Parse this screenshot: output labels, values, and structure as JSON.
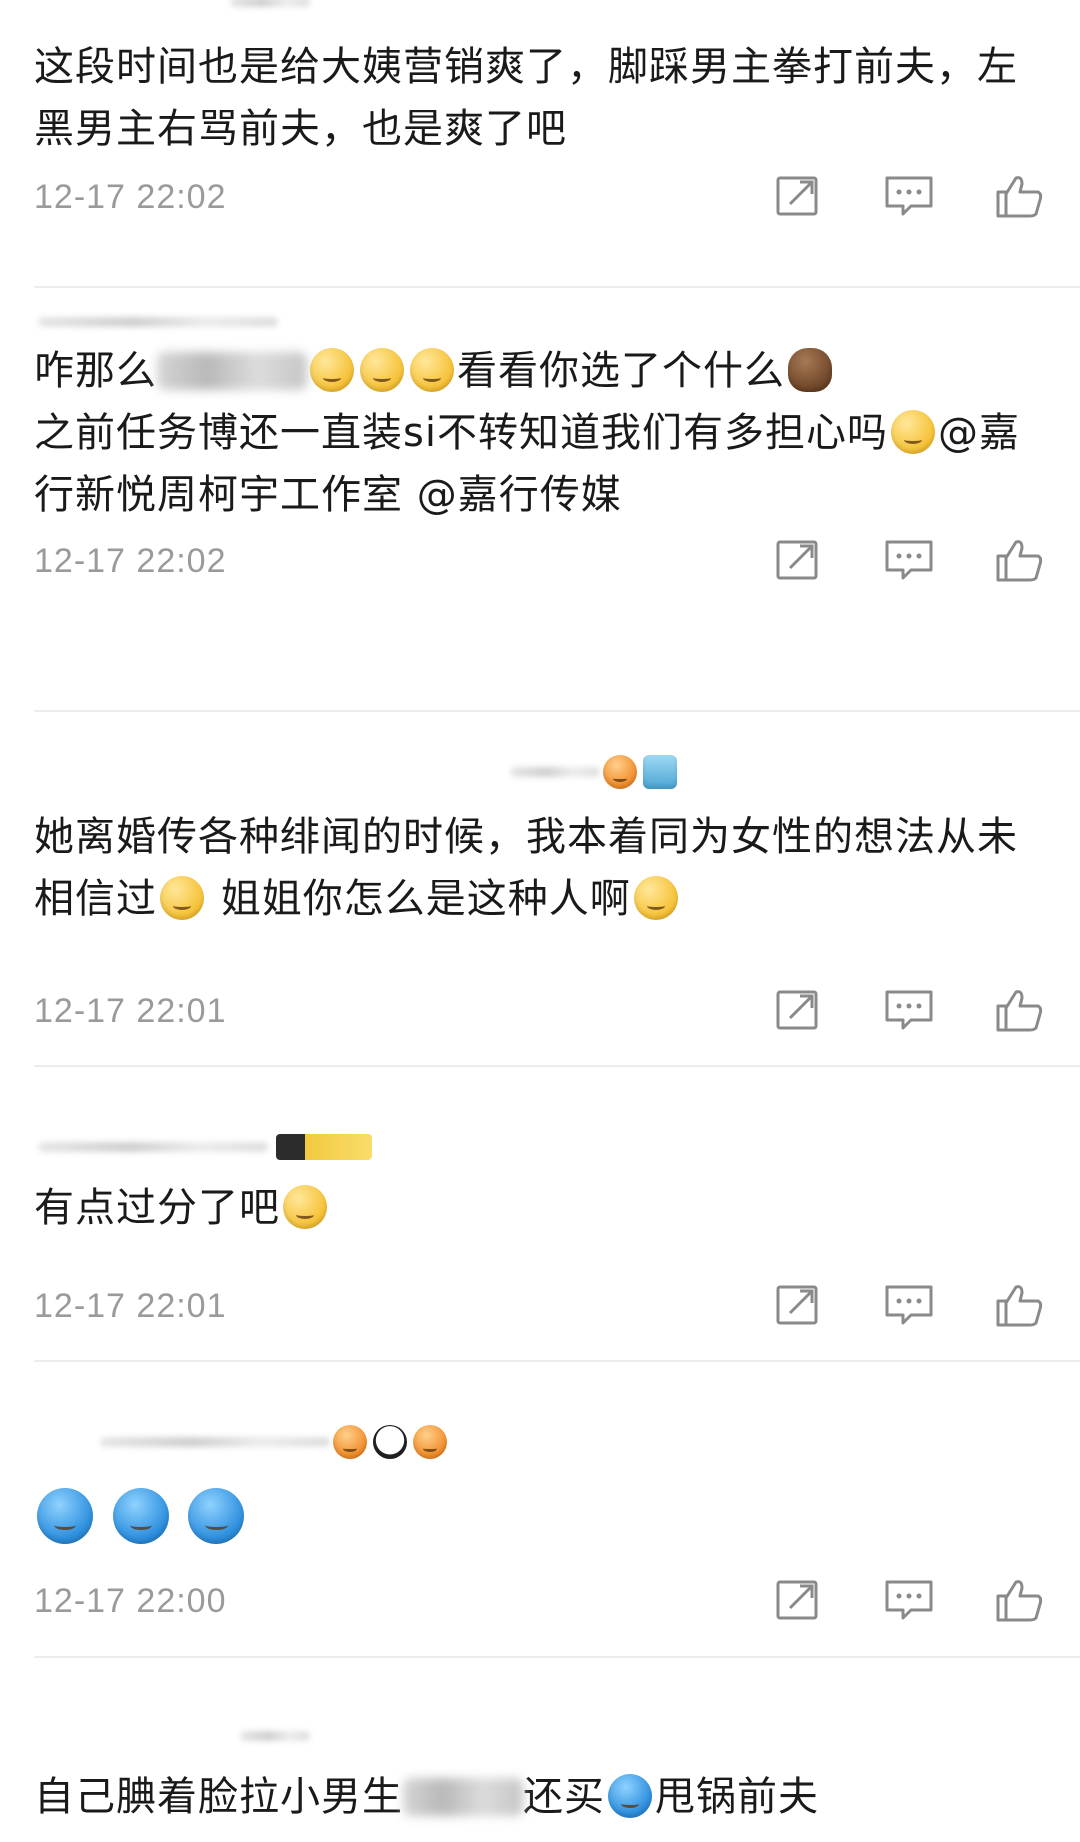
{
  "comments": [
    {
      "text": "这段时间也是给大姨营销爽了，脚踩男主拳打前夫，左黑男主右骂前夫，也是爽了吧",
      "time": "12-17 22:02"
    },
    {
      "text_a": "咋那么",
      "text_b": "看看你选了个什么",
      "text_c": "之前任务博还一直装si不转知道我们有多担心吗",
      "text_d": "@嘉行新悦周柯宇工作室 @嘉行传媒",
      "time": "12-17 22:02"
    },
    {
      "text_a": "她离婚传各种绯闻的时候，我本着同为女性的想法从未相信过",
      "text_b": "姐姐你怎么是这种人啊",
      "time": "12-17 22:01"
    },
    {
      "text": "有点过分了吧",
      "time": "12-17 22:01"
    },
    {
      "time": "12-17 22:00"
    },
    {
      "text_a": "自己腆着脸拉小男生",
      "text_b": "还买",
      "text_c": "甩锅前夫"
    }
  ],
  "icons": {
    "share": "share-icon",
    "comment": "comment-icon",
    "like": "like-icon"
  },
  "colors": {
    "timestamp": "#9a9a9a",
    "icon": "#8a8a8a",
    "divider": "#ececec"
  }
}
